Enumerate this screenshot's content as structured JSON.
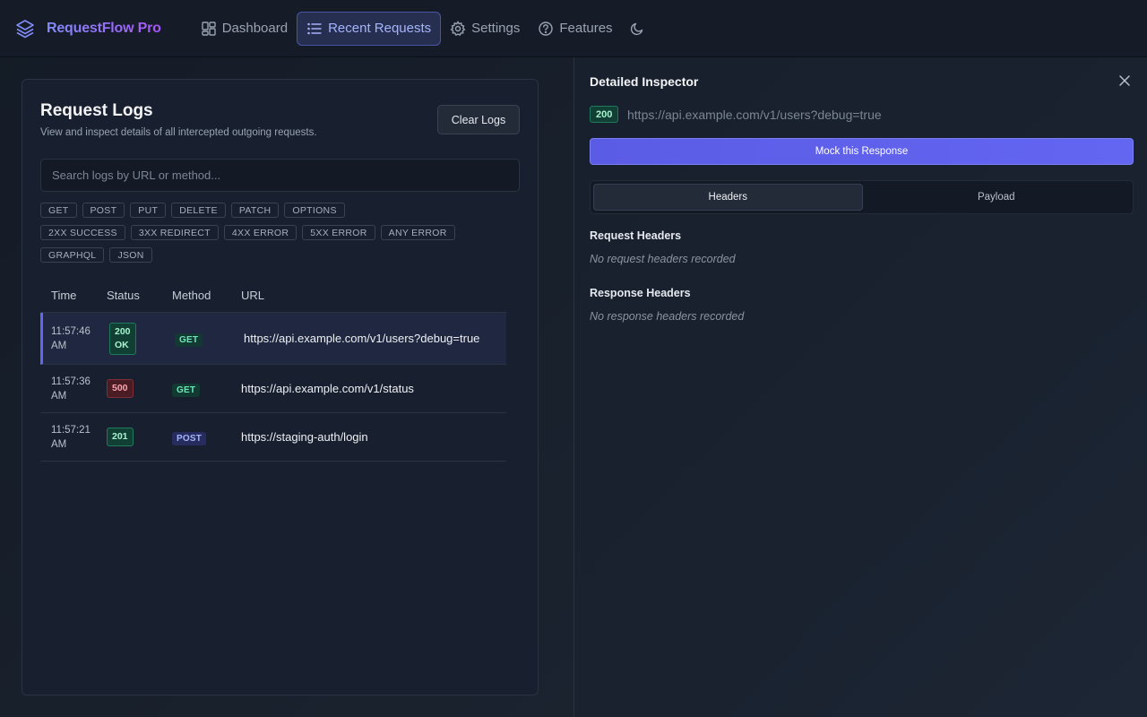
{
  "app": {
    "name": "RequestFlow Pro"
  },
  "nav": {
    "items": [
      {
        "label": "Dashboard",
        "icon": "dashboard-icon"
      },
      {
        "label": "Recent Requests",
        "icon": "list-icon",
        "active": true
      },
      {
        "label": "Settings",
        "icon": "gear-icon"
      },
      {
        "label": "Features",
        "icon": "help-circle-icon"
      }
    ],
    "theme_icon": "moon-icon"
  },
  "logs": {
    "title": "Request Logs",
    "subtitle": "View and inspect details of all intercepted outgoing requests.",
    "clear_label": "Clear Logs",
    "search_placeholder": "Search logs by URL or method...",
    "filters_methods": [
      "GET",
      "POST",
      "PUT",
      "DELETE",
      "PATCH",
      "OPTIONS"
    ],
    "filters_status": [
      "2XX SUCCESS",
      "3XX REDIRECT",
      "4XX ERROR",
      "5XX ERROR",
      "ANY ERROR"
    ],
    "filters_type": [
      "GRAPHQL",
      "JSON"
    ],
    "columns": {
      "time": "Time",
      "status": "Status",
      "method": "Method",
      "url": "URL"
    },
    "rows": [
      {
        "time_1": "11:57:46",
        "time_2": "AM",
        "status_1": "200",
        "status_2": "OK",
        "method": "GET",
        "url": "https://api.example.com/v1/users?debug=true"
      },
      {
        "time_1": "11:57:36",
        "time_2": "AM",
        "status_1": "500",
        "status_2": "",
        "method": "GET",
        "url": "https://api.example.com/v1/status"
      },
      {
        "time_1": "11:57:21",
        "time_2": "AM",
        "status_1": "201",
        "status_2": "",
        "method": "POST",
        "url": "https://staging-auth/login"
      }
    ]
  },
  "inspector": {
    "title": "Detailed Inspector",
    "status": "200",
    "url": "https://api.example.com/v1/users?debug=true",
    "mock_label": "Mock this Response",
    "tabs": [
      "Headers",
      "Payload"
    ],
    "request_headers_title": "Request Headers",
    "request_headers_empty": "No request headers recorded",
    "response_headers_title": "Response Headers",
    "response_headers_empty": "No response headers recorded"
  },
  "colors": {
    "accent": "#6366f1",
    "success": "#1f7a5d",
    "error": "#7f2d38"
  }
}
